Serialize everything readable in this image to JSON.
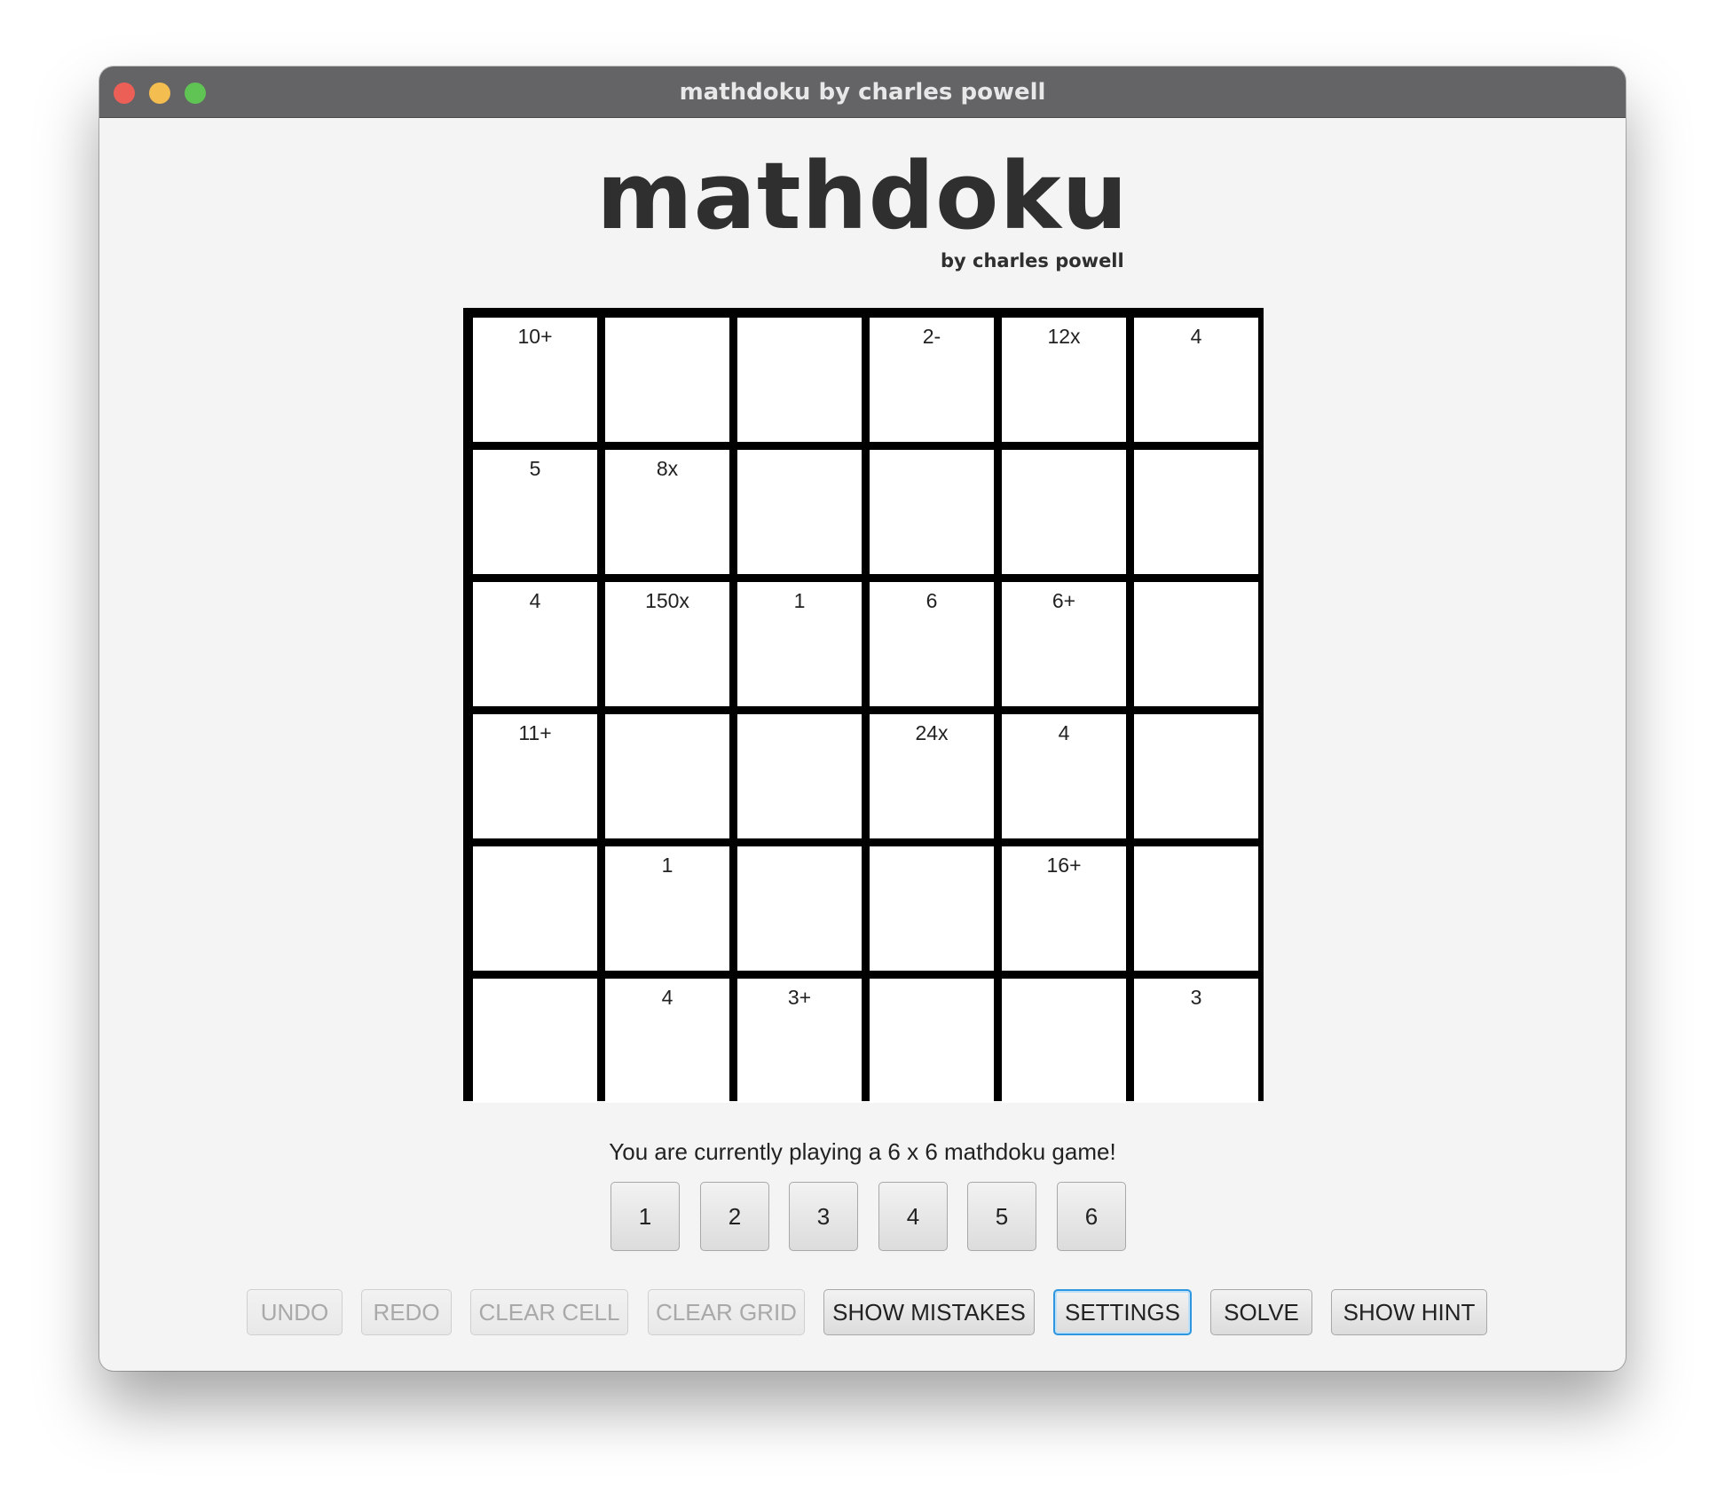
{
  "window": {
    "title": "mathdoku by charles powell"
  },
  "header": {
    "title": "mathdoku",
    "subtitle": "by charles powell"
  },
  "grid": {
    "size": 6,
    "cells": [
      {
        "row": 0,
        "col": 0,
        "label": "10+"
      },
      {
        "row": 0,
        "col": 1,
        "label": ""
      },
      {
        "row": 0,
        "col": 2,
        "label": ""
      },
      {
        "row": 0,
        "col": 3,
        "label": "2-"
      },
      {
        "row": 0,
        "col": 4,
        "label": "12x"
      },
      {
        "row": 0,
        "col": 5,
        "label": "4"
      },
      {
        "row": 1,
        "col": 0,
        "label": "5"
      },
      {
        "row": 1,
        "col": 1,
        "label": "8x"
      },
      {
        "row": 1,
        "col": 2,
        "label": ""
      },
      {
        "row": 1,
        "col": 3,
        "label": ""
      },
      {
        "row": 1,
        "col": 4,
        "label": ""
      },
      {
        "row": 1,
        "col": 5,
        "label": ""
      },
      {
        "row": 2,
        "col": 0,
        "label": "4"
      },
      {
        "row": 2,
        "col": 1,
        "label": "150x"
      },
      {
        "row": 2,
        "col": 2,
        "label": "1"
      },
      {
        "row": 2,
        "col": 3,
        "label": "6"
      },
      {
        "row": 2,
        "col": 4,
        "label": "6+"
      },
      {
        "row": 2,
        "col": 5,
        "label": ""
      },
      {
        "row": 3,
        "col": 0,
        "label": "11+"
      },
      {
        "row": 3,
        "col": 1,
        "label": ""
      },
      {
        "row": 3,
        "col": 2,
        "label": ""
      },
      {
        "row": 3,
        "col": 3,
        "label": "24x"
      },
      {
        "row": 3,
        "col": 4,
        "label": "4"
      },
      {
        "row": 3,
        "col": 5,
        "label": ""
      },
      {
        "row": 4,
        "col": 0,
        "label": ""
      },
      {
        "row": 4,
        "col": 1,
        "label": "1"
      },
      {
        "row": 4,
        "col": 2,
        "label": ""
      },
      {
        "row": 4,
        "col": 3,
        "label": ""
      },
      {
        "row": 4,
        "col": 4,
        "label": "16+"
      },
      {
        "row": 4,
        "col": 5,
        "label": ""
      },
      {
        "row": 5,
        "col": 0,
        "label": ""
      },
      {
        "row": 5,
        "col": 1,
        "label": "4"
      },
      {
        "row": 5,
        "col": 2,
        "label": "3+"
      },
      {
        "row": 5,
        "col": 3,
        "label": ""
      },
      {
        "row": 5,
        "col": 4,
        "label": ""
      },
      {
        "row": 5,
        "col": 5,
        "label": "3"
      }
    ]
  },
  "status": {
    "text": "You are currently playing a 6 x 6 mathdoku game!"
  },
  "number_buttons": [
    "1",
    "2",
    "3",
    "4",
    "5",
    "6"
  ],
  "actions": {
    "undo": "UNDO",
    "redo": "REDO",
    "clear_cell": "CLEAR CELL",
    "clear_grid": "CLEAR GRID",
    "show_mistakes": "SHOW MISTAKES",
    "settings": "SETTINGS",
    "solve": "SOLVE",
    "show_hint": "SHOW HINT"
  }
}
